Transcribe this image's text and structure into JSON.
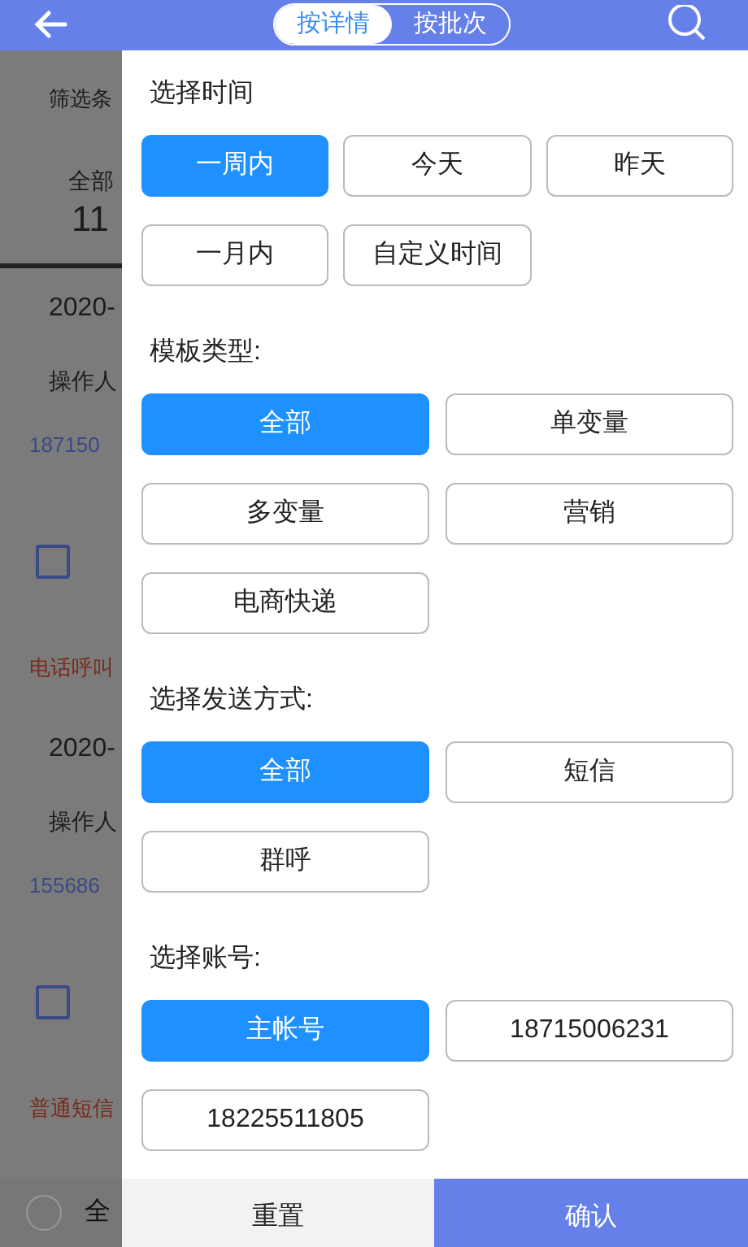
{
  "header": {
    "tabs": [
      {
        "label": "按详情",
        "selected": true
      },
      {
        "label": "按批次",
        "selected": false
      }
    ]
  },
  "background_list": {
    "filter_label": "筛选条",
    "tab_label": "全部",
    "tab_count": "11",
    "records": [
      {
        "date": "2020-",
        "operator": "操作人",
        "phone": "187150",
        "checked": false,
        "type": "电话呼叫"
      },
      {
        "date": "2020-",
        "operator": "操作人",
        "phone": "155686",
        "checked": false,
        "type": "普通短信"
      }
    ],
    "select_all": {
      "label": "全",
      "checked": false
    }
  },
  "filter_sections": [
    {
      "title": "选择时间",
      "kind": "three_column",
      "options": [
        {
          "label": "一周内",
          "selected": true
        },
        {
          "label": "今天",
          "selected": false
        },
        {
          "label": "昨天",
          "selected": false
        },
        {
          "label": "一月内",
          "selected": false
        },
        {
          "label": "自定义时间",
          "selected": false
        }
      ]
    },
    {
      "title": "模板类型:",
      "kind": "two_column",
      "options": [
        {
          "label": "全部",
          "selected": true
        },
        {
          "label": "单变量",
          "selected": false
        },
        {
          "label": "多变量",
          "selected": false
        },
        {
          "label": "营销",
          "selected": false
        },
        {
          "label": "电商快递",
          "selected": false
        }
      ]
    },
    {
      "title": "选择发送方式:",
      "kind": "two_column",
      "options": [
        {
          "label": "全部",
          "selected": true
        },
        {
          "label": "短信",
          "selected": false
        },
        {
          "label": "群呼",
          "selected": false
        }
      ]
    },
    {
      "title": "选择账号:",
      "kind": "two_column",
      "options": [
        {
          "label": "主帐号",
          "selected": true
        },
        {
          "label": "18715006231",
          "selected": false
        },
        {
          "label": "18225511805",
          "selected": false
        }
      ]
    }
  ],
  "footer": {
    "reset": "重置",
    "confirm": "确认"
  }
}
